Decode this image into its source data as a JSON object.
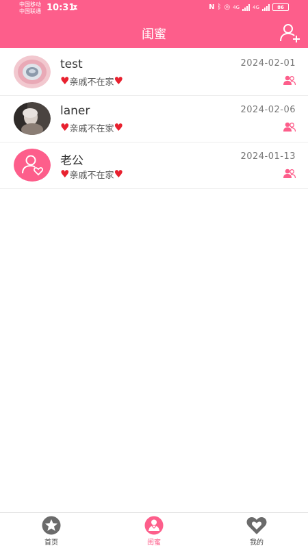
{
  "status_bar": {
    "carrier_1": "中国移动",
    "carrier_2": "中国联通",
    "time": "10:31",
    "network_1": "4G",
    "network_2": "4G",
    "battery": "86"
  },
  "header": {
    "title": "闺蜜",
    "add_icon": "add-user-icon"
  },
  "contacts": [
    {
      "name": "test",
      "status": "亲戚不在家",
      "date": "2024-02-01",
      "avatar": "plate-photo"
    },
    {
      "name": "laner",
      "status": "亲戚不在家",
      "date": "2024-02-06",
      "avatar": "person-photo"
    },
    {
      "name": "老公",
      "status": "亲戚不在家",
      "date": "2024-01-13",
      "avatar": "user-heart-icon"
    }
  ],
  "tabs": [
    {
      "label": "首页",
      "icon": "star-icon",
      "active": false
    },
    {
      "label": "闺蜜",
      "icon": "bestie-icon",
      "active": true
    },
    {
      "label": "我的",
      "icon": "heart-icon",
      "active": false
    }
  ],
  "colors": {
    "accent": "#fd5e8b",
    "heart": "#e8212f",
    "tab_inactive": "#6b6b6b"
  }
}
